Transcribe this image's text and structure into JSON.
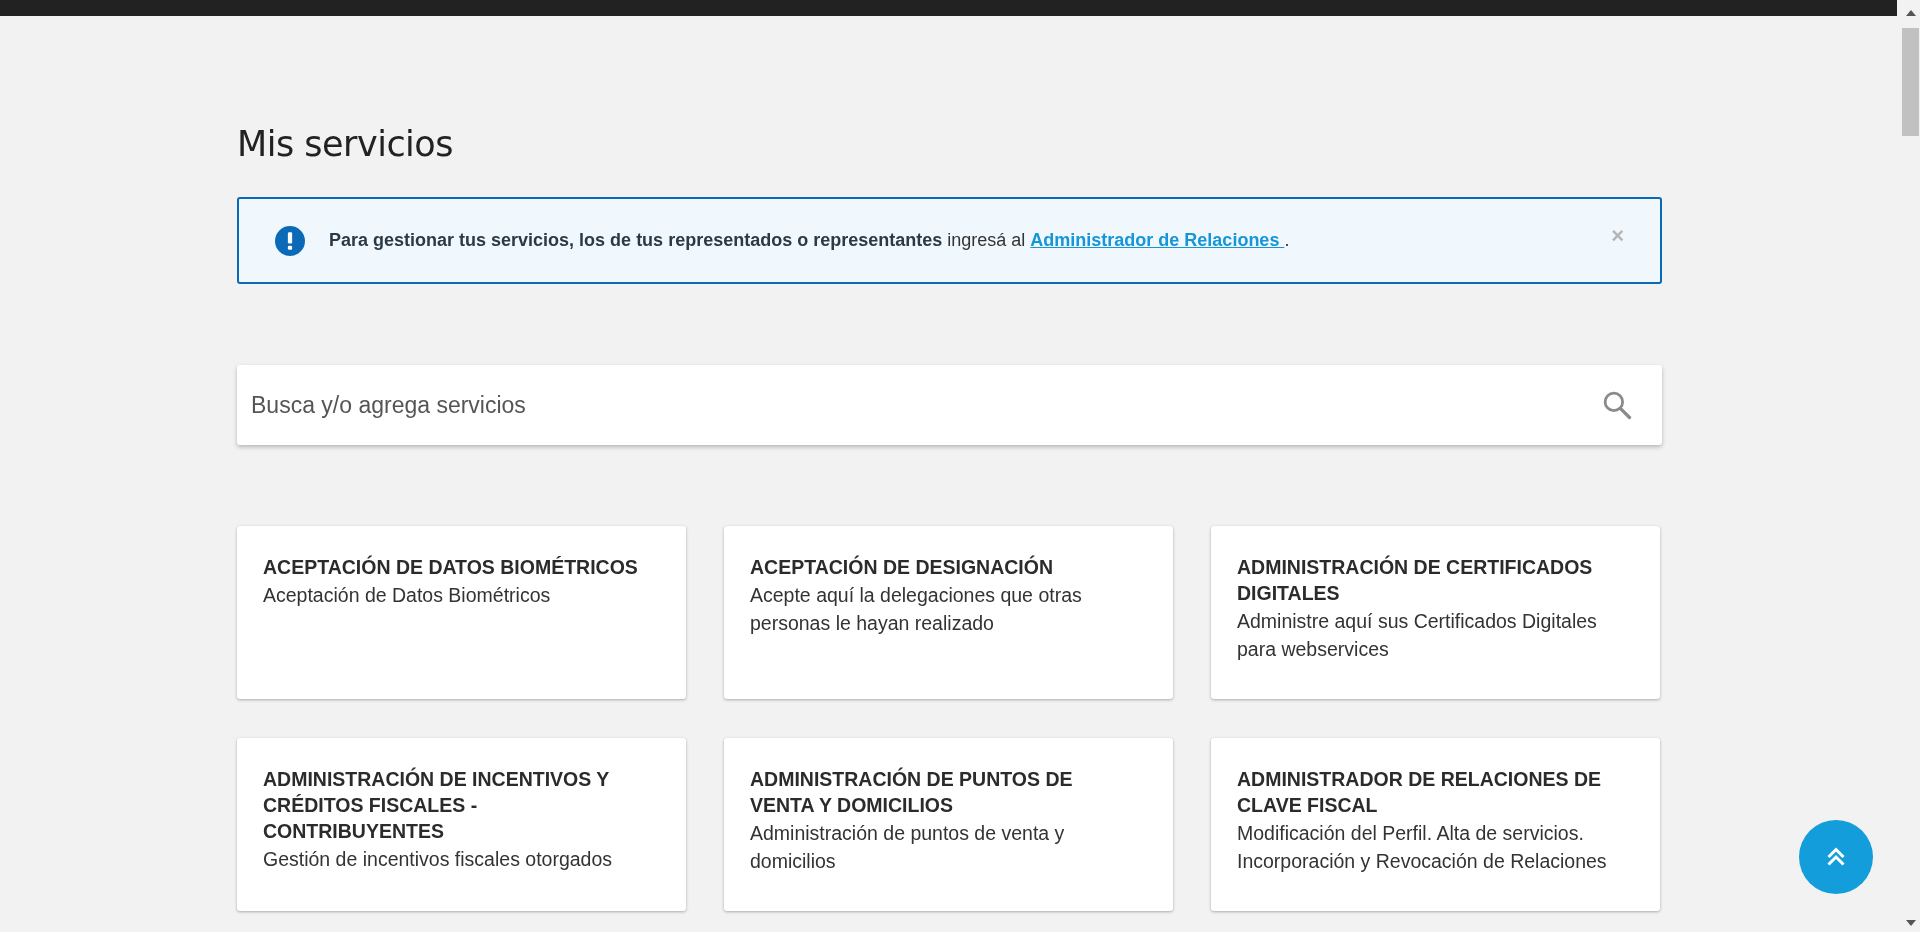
{
  "page_title": "Mis servicios",
  "alert": {
    "text": "**Para gestionar tus servicios, los de tus representados o representantes** ingresá al",
    "link": "Administrador de Relaciones ",
    "after_link": ".",
    "close": "×"
  },
  "search": {
    "placeholder": "Busca y/o agrega servicios"
  },
  "services": [
    {
      "title": "ACEPTACIÓN DE DATOS BIOMÉTRICOS",
      "description": "Aceptación de Datos Biométricos"
    },
    {
      "title": "ACEPTACIÓN DE DESIGNACIÓN",
      "description": "Acepte aquí la delegaciones que otras personas le hayan realizado"
    },
    {
      "title": "ADMINISTRACIÓN DE CERTIFICADOS DIGITALES",
      "description": "Administre aquí sus Certificados Digitales para webservices"
    },
    {
      "title": "ADMINISTRACIÓN DE INCENTIVOS Y CRÉDITOS FISCALES - CONTRIBUYENTES",
      "description": "Gestión de incentivos fiscales otorgados"
    },
    {
      "title": "ADMINISTRACIÓN DE PUNTOS DE VENTA Y DOMICILIOS",
      "description": "Administración de puntos de venta y domicilios"
    },
    {
      "title": "ADMINISTRADOR DE RELACIONES DE CLAVE FISCAL",
      "description": "Modificación del Perfil. Alta de servicios. Incorporación y Revocación de Relaciones"
    }
  ]
}
